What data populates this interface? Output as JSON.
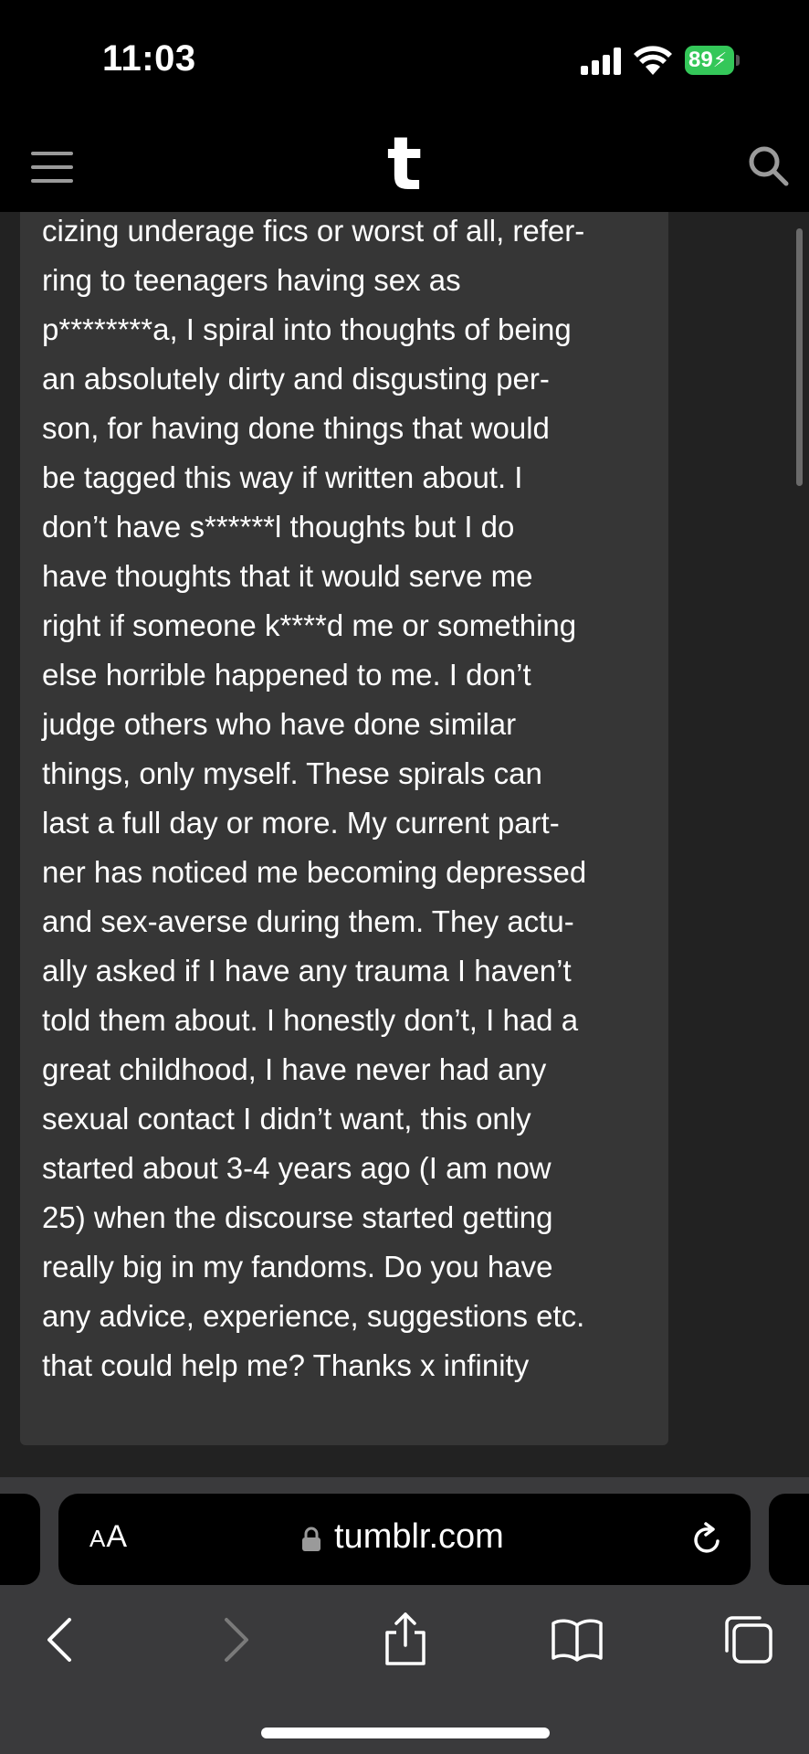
{
  "status_bar": {
    "time": "11:03",
    "battery": "89"
  },
  "app_header": {
    "logo": "t",
    "menu_icon": "hamburger-icon",
    "search_icon": "search-icon"
  },
  "post": {
    "body": "cizing underage fics or worst of all, refer-\nring to teenagers having sex as\np********a, I spiral into thoughts of being\nan absolutely dirty and disgusting per-\nson, for having done things that would\nbe tagged this way if written about. I\ndon’t have s******l thoughts but I do\nhave thoughts that it would serve me\nright if someone k****d me or something\nelse horrible happened to me. I don’t\njudge others who have done similar\nthings, only myself. These spirals can\nlast a full day or more. My current part-\nner has noticed me becoming depressed\nand sex-averse during them. They actu-\nally asked if I have any trauma I haven’t\ntold them about. I honestly don’t, I had a\ngreat childhood, I have never had any\nsexual contact I didn’t want, this only\nstarted about 3-4 years ago (I am now\n25) when the discourse started getting\nreally big in my fandoms. Do you have\nany advice, experience, suggestions etc.\nthat could help me? Thanks x infinity"
  },
  "browser": {
    "aa_small": "A",
    "aa_large": "A",
    "url": "tumblr.com",
    "icons": [
      "lock-icon",
      "reload-icon",
      "back-icon",
      "forward-icon",
      "share-icon",
      "bookmarks-icon",
      "tabs-icon"
    ]
  }
}
